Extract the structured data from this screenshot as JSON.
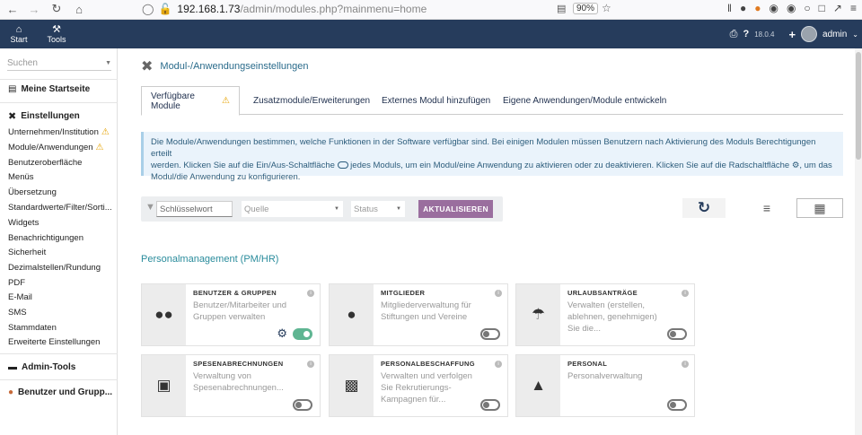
{
  "browser": {
    "url_host": "192.168.1.73",
    "url_path": "/admin/modules.php?mainmenu=home",
    "zoom": "90%"
  },
  "topnav": {
    "items": [
      {
        "label": "Start",
        "icon": "home-icon"
      },
      {
        "label": "Tools",
        "icon": "wrench-icon"
      }
    ],
    "version": "18.0.4",
    "user": "admin"
  },
  "sidebar": {
    "search_placeholder": "Suchen",
    "groups": {
      "home": "Meine Startseite",
      "settings": "Einstellungen",
      "admin_tools": "Admin-Tools",
      "users": "Benutzer und Grupp..."
    },
    "items": [
      "Unternehmen/Institution",
      "Module/Anwendungen",
      "Benutzeroberfläche",
      "Menüs",
      "Übersetzung",
      "Standardwerte/Filter/Sorti...",
      "Widgets",
      "Benachrichtigungen",
      "Sicherheit",
      "Dezimalstellen/Rundung",
      "PDF",
      "E-Mail",
      "SMS",
      "Stammdaten",
      "Erweiterte Einstellungen"
    ]
  },
  "main": {
    "title": "Modul-/Anwendungseinstellungen",
    "tabs": [
      "Verfügbare Module",
      "Zusatzmodule/Erweiterungen",
      "Externes Modul hinzufügen",
      "Eigene Anwendungen/Module entwickeln"
    ],
    "info_line1": "Die Module/Anwendungen bestimmen, welche Funktionen in der Software verfügbar sind. Bei einigen Modulen müssen Benutzern nach Aktivierung des Moduls Berechtigungen erteilt",
    "info_line2a": "werden. Klicken Sie auf die Ein/Aus-Schaltfläche",
    "info_line2b": "jedes Moduls, um ein Modul/eine Anwendung zu aktivieren oder zu deaktivieren. Klicken Sie auf die Radschaltfläche",
    "info_line2c": ", um das",
    "info_line3": "Modul/die Anwendung zu konfigurieren.",
    "filter": {
      "keyword_placeholder": "Schlüsselwort",
      "source_placeholder": "Quelle",
      "status_placeholder": "Status",
      "refresh_label": "AKTUALISIEREN"
    },
    "section_title": "Personalmanagement (PM/HR)",
    "cards": [
      {
        "title": "BENUTZER & GRUPPEN",
        "desc": "Benutzer/Mitarbeiter und Gruppen verwalten",
        "icon": "users-icon",
        "enabled": true
      },
      {
        "title": "MITGLIEDER",
        "desc": "Mitgliederverwaltung für Stiftungen und Vereine",
        "icon": "member-icon",
        "enabled": false
      },
      {
        "title": "URLAUBSANTRÄGE",
        "desc": "Verwalten (erstellen, ablehnen, genehmigen) Sie die...",
        "icon": "beach-umbrella-icon",
        "enabled": false
      },
      {
        "title": "SPESENABRECHNUNGEN",
        "desc": "Verwaltung von Spesenabrechnungen...",
        "icon": "wallet-icon",
        "enabled": false
      },
      {
        "title": "PERSONALBESCHAFFUNG",
        "desc": "Verwalten und verfolgen Sie Rekrutierungs-Kampagnen für...",
        "icon": "id-badge-icon",
        "enabled": false
      },
      {
        "title": "PERSONAL",
        "desc": "Personalverwaltung",
        "icon": "user-tie-icon",
        "enabled": false
      }
    ]
  }
}
